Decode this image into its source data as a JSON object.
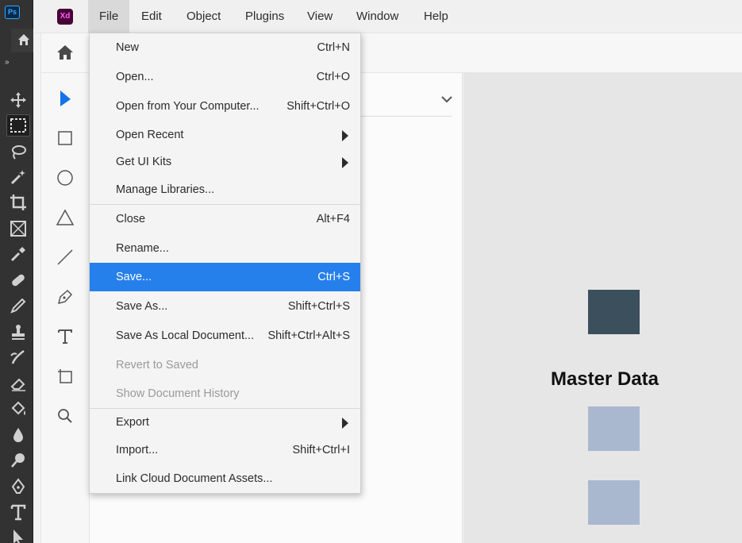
{
  "photoshop": {
    "logo": "Ps",
    "collapse_glyph": "»",
    "tools": [
      "move-icon",
      "marquee-icon",
      "lasso-icon",
      "magic-wand-icon",
      "crop-icon",
      "frame-icon",
      "eyedropper-icon",
      "healing-brush-icon",
      "brush-icon",
      "clone-stamp-icon",
      "history-brush-icon",
      "eraser-icon",
      "paint-bucket-icon",
      "blur-icon",
      "dodge-icon",
      "pen-icon",
      "type-icon",
      "path-selection-icon"
    ]
  },
  "xd": {
    "logo": "Xd",
    "menu": [
      "File",
      "Edit",
      "Object",
      "Plugins",
      "View",
      "Window",
      "Help"
    ],
    "active_menu": "File",
    "side_tools": [
      "home-icon",
      "select-icon",
      "rectangle-icon",
      "ellipse-icon",
      "triangle-icon",
      "line-icon",
      "pen-icon",
      "text-icon",
      "artboard-icon",
      "zoom-icon"
    ]
  },
  "file_menu": {
    "items": [
      {
        "label": "New",
        "shortcut": "Ctrl+N"
      },
      {
        "label": "Open...",
        "shortcut": "Ctrl+O"
      },
      {
        "label": "Open from Your Computer...",
        "shortcut": "Shift+Ctrl+O"
      },
      {
        "label": "Open Recent",
        "shortcut": ""
      },
      {
        "label": "Get UI Kits",
        "shortcut": ""
      },
      {
        "label": "Manage Libraries...",
        "shortcut": ""
      },
      {
        "label": "Close",
        "shortcut": "Alt+F4"
      },
      {
        "label": "Rename...",
        "shortcut": ""
      },
      {
        "label": "Save...",
        "shortcut": "Ctrl+S"
      },
      {
        "label": "Save As...",
        "shortcut": "Shift+Ctrl+S"
      },
      {
        "label": "Save As Local Document...",
        "shortcut": "Shift+Ctrl+Alt+S"
      },
      {
        "label": "Revert to Saved",
        "shortcut": ""
      },
      {
        "label": "Show Document History",
        "shortcut": ""
      },
      {
        "label": "Export",
        "shortcut": ""
      },
      {
        "label": "Import...",
        "shortcut": "Shift+Ctrl+I"
      },
      {
        "label": "Link Cloud Document Assets...",
        "shortcut": ""
      }
    ],
    "highlighted": "Save...",
    "disabled": [
      "Revert to Saved",
      "Show Document History"
    ],
    "submenus": [
      "Open Recent",
      "Get UI Kits",
      "Export"
    ]
  },
  "canvas": {
    "title": "Master Data"
  },
  "colors": {
    "highlight": "#2680eb",
    "selected_tool": "#1473e6",
    "swatch_dark": "#3b4f5c",
    "swatch_light": "#a9b8cf"
  }
}
